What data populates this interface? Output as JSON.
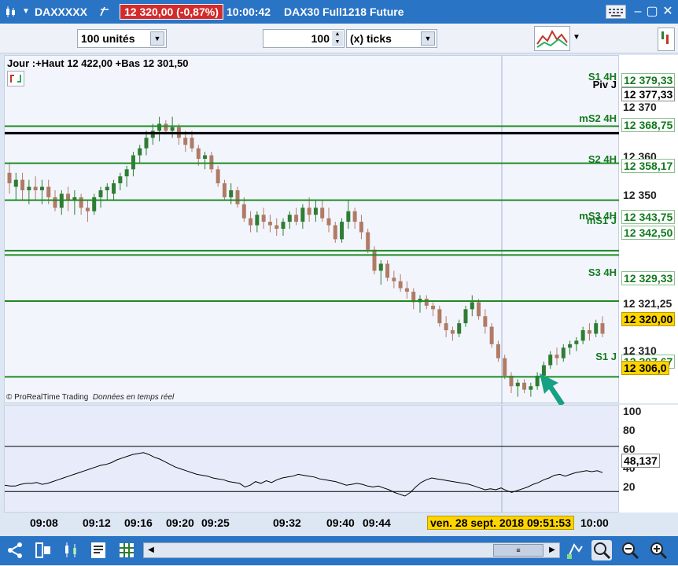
{
  "window": {
    "symbol": "DAXXXXX",
    "last_price": "12 320,00 (-0,87%)",
    "time": "10:00:42",
    "instrument": "DAX30 Full1218 Future"
  },
  "toolbar": {
    "units_value": "100 unités",
    "ticks_count": "100",
    "ticks_unit": "(x) ticks"
  },
  "chart_header": "Jour :+Haut 12 422,00 +Bas 12 301,50",
  "watermark": {
    "brand": "© ProRealTime Trading",
    "feed": "Données en temps réel"
  },
  "level_labels": [
    {
      "text": "S1 4H"
    },
    {
      "text": "Piv J"
    },
    {
      "text": "mS2 4H"
    },
    {
      "text": "S2 4H"
    },
    {
      "text": "mS3 4H"
    },
    {
      "text": "mS1 J"
    },
    {
      "text": "S3 4H"
    },
    {
      "text": "S1 J"
    }
  ],
  "price_axis": [
    {
      "text": "12 379,33",
      "style": "green"
    },
    {
      "text": "12 377,33",
      "style": "black"
    },
    {
      "text": "12 370",
      "style": "plain"
    },
    {
      "text": "12 368,75",
      "style": "green"
    },
    {
      "text": "12 360",
      "style": "plain"
    },
    {
      "text": "12 358,17",
      "style": "green"
    },
    {
      "text": "12 350",
      "style": "plain"
    },
    {
      "text": "12 343,75",
      "style": "green"
    },
    {
      "text": "12 342,50",
      "style": "green"
    },
    {
      "text": "12 329,33",
      "style": "green"
    },
    {
      "text": "12 321,25",
      "style": "plain"
    },
    {
      "text": "12 320,00",
      "style": "yellow"
    },
    {
      "text": "12 310",
      "style": "plain"
    },
    {
      "text": "12 307,67",
      "style": "green"
    },
    {
      "text": "12 306,0",
      "style": "yellow"
    }
  ],
  "indicator_axis": {
    "ticks": [
      "100",
      "80",
      "60",
      "40",
      "20"
    ],
    "current": "48,137"
  },
  "time_axis": {
    "ticks": [
      "09:08",
      "09:12",
      "09:16",
      "09:20",
      "09:25",
      "09:32",
      "09:40",
      "09:44",
      "10:00"
    ],
    "cursor": "ven. 28 sept. 2018 09:51:53"
  },
  "colors": {
    "up": "#2e7d32",
    "down": "#b07b66",
    "level": "#1e8b23",
    "pivot": "#000000",
    "highlight": "#ffd400",
    "title_bar": "#2a74c5",
    "arrow": "#16a085"
  },
  "chart_data": {
    "type": "candlestick",
    "ylim": [
      12300,
      12385
    ],
    "levels": [
      {
        "name": "S1 4H",
        "value": 12379.33
      },
      {
        "name": "Piv J",
        "value": 12377.33
      },
      {
        "name": "mS2 4H",
        "value": 12368.75
      },
      {
        "name": "S2 4H",
        "value": 12358.17
      },
      {
        "name": "mS3 4H",
        "value": 12343.75
      },
      {
        "name": "mS1 J",
        "value": 12342.5
      },
      {
        "name": "S3 4H",
        "value": 12329.33
      },
      {
        "name": "S1 J",
        "value": 12307.67
      }
    ],
    "candles": [
      {
        "o": 12366,
        "h": 12369,
        "l": 12360,
        "c": 12363
      },
      {
        "o": 12362,
        "h": 12366,
        "l": 12358,
        "c": 12364
      },
      {
        "o": 12364,
        "h": 12366,
        "l": 12358,
        "c": 12361
      },
      {
        "o": 12361,
        "h": 12364,
        "l": 12357,
        "c": 12362
      },
      {
        "o": 12362,
        "h": 12365,
        "l": 12358,
        "c": 12361
      },
      {
        "o": 12361,
        "h": 12364,
        "l": 12357,
        "c": 12362
      },
      {
        "o": 12362,
        "h": 12364,
        "l": 12357,
        "c": 12359
      },
      {
        "o": 12359,
        "h": 12361,
        "l": 12355,
        "c": 12356
      },
      {
        "o": 12356,
        "h": 12361,
        "l": 12354,
        "c": 12360
      },
      {
        "o": 12360,
        "h": 12362,
        "l": 12355,
        "c": 12358
      },
      {
        "o": 12358,
        "h": 12361,
        "l": 12354,
        "c": 12359
      },
      {
        "o": 12359,
        "h": 12360,
        "l": 12354,
        "c": 12356
      },
      {
        "o": 12356,
        "h": 12358,
        "l": 12352,
        "c": 12355
      },
      {
        "o": 12355,
        "h": 12360,
        "l": 12354,
        "c": 12359
      },
      {
        "o": 12359,
        "h": 12362,
        "l": 12356,
        "c": 12361
      },
      {
        "o": 12361,
        "h": 12363,
        "l": 12358,
        "c": 12362
      },
      {
        "o": 12360,
        "h": 12364,
        "l": 12358,
        "c": 12363
      },
      {
        "o": 12363,
        "h": 12366,
        "l": 12361,
        "c": 12365
      },
      {
        "o": 12365,
        "h": 12368,
        "l": 12362,
        "c": 12367
      },
      {
        "o": 12367,
        "h": 12372,
        "l": 12365,
        "c": 12371
      },
      {
        "o": 12371,
        "h": 12374,
        "l": 12369,
        "c": 12373
      },
      {
        "o": 12373,
        "h": 12378,
        "l": 12371,
        "c": 12376
      },
      {
        "o": 12376,
        "h": 12380,
        "l": 12374,
        "c": 12378
      },
      {
        "o": 12378,
        "h": 12382,
        "l": 12375,
        "c": 12380
      },
      {
        "o": 12380,
        "h": 12381,
        "l": 12377,
        "c": 12378
      },
      {
        "o": 12378,
        "h": 12382,
        "l": 12376,
        "c": 12379
      },
      {
        "o": 12379,
        "h": 12380,
        "l": 12374,
        "c": 12376
      },
      {
        "o": 12376,
        "h": 12378,
        "l": 12372,
        "c": 12374
      },
      {
        "o": 12376,
        "h": 12378,
        "l": 12372,
        "c": 12373
      },
      {
        "o": 12373,
        "h": 12374,
        "l": 12368,
        "c": 12370
      },
      {
        "o": 12370,
        "h": 12372,
        "l": 12367,
        "c": 12371
      },
      {
        "o": 12371,
        "h": 12372,
        "l": 12366,
        "c": 12367
      },
      {
        "o": 12367,
        "h": 12368,
        "l": 12362,
        "c": 12363
      },
      {
        "o": 12363,
        "h": 12364,
        "l": 12358,
        "c": 12359
      },
      {
        "o": 12359,
        "h": 12363,
        "l": 12357,
        "c": 12361
      },
      {
        "o": 12361,
        "h": 12362,
        "l": 12356,
        "c": 12357
      },
      {
        "o": 12357,
        "h": 12359,
        "l": 12352,
        "c": 12353
      },
      {
        "o": 12353,
        "h": 12355,
        "l": 12349,
        "c": 12351
      },
      {
        "o": 12351,
        "h": 12355,
        "l": 12349,
        "c": 12354
      },
      {
        "o": 12354,
        "h": 12356,
        "l": 12350,
        "c": 12352
      },
      {
        "o": 12352,
        "h": 12354,
        "l": 12349,
        "c": 12351
      },
      {
        "o": 12351,
        "h": 12353,
        "l": 12348,
        "c": 12350
      },
      {
        "o": 12350,
        "h": 12353,
        "l": 12348,
        "c": 12352
      },
      {
        "o": 12352,
        "h": 12355,
        "l": 12350,
        "c": 12354
      },
      {
        "o": 12354,
        "h": 12356,
        "l": 12351,
        "c": 12352
      },
      {
        "o": 12352,
        "h": 12357,
        "l": 12350,
        "c": 12356
      },
      {
        "o": 12356,
        "h": 12359,
        "l": 12352,
        "c": 12354
      },
      {
        "o": 12354,
        "h": 12358,
        "l": 12352,
        "c": 12356
      },
      {
        "o": 12356,
        "h": 12358,
        "l": 12352,
        "c": 12353
      },
      {
        "o": 12353,
        "h": 12356,
        "l": 12349,
        "c": 12351
      },
      {
        "o": 12351,
        "h": 12352,
        "l": 12346,
        "c": 12347
      },
      {
        "o": 12347,
        "h": 12353,
        "l": 12346,
        "c": 12352
      },
      {
        "o": 12352,
        "h": 12358,
        "l": 12350,
        "c": 12355
      },
      {
        "o": 12355,
        "h": 12356,
        "l": 12350,
        "c": 12352
      },
      {
        "o": 12352,
        "h": 12354,
        "l": 12347,
        "c": 12349
      },
      {
        "o": 12349,
        "h": 12350,
        "l": 12343,
        "c": 12344
      },
      {
        "o": 12344,
        "h": 12345,
        "l": 12337,
        "c": 12338
      },
      {
        "o": 12338,
        "h": 12341,
        "l": 12334,
        "c": 12340
      },
      {
        "o": 12340,
        "h": 12341,
        "l": 12335,
        "c": 12336
      },
      {
        "o": 12336,
        "h": 12338,
        "l": 12333,
        "c": 12335
      },
      {
        "o": 12335,
        "h": 12337,
        "l": 12332,
        "c": 12333
      },
      {
        "o": 12333,
        "h": 12335,
        "l": 12330,
        "c": 12332
      },
      {
        "o": 12332,
        "h": 12333,
        "l": 12327,
        "c": 12329
      },
      {
        "o": 12329,
        "h": 12331,
        "l": 12326,
        "c": 12330
      },
      {
        "o": 12330,
        "h": 12331,
        "l": 12327,
        "c": 12328
      },
      {
        "o": 12328,
        "h": 12329,
        "l": 12325,
        "c": 12327
      },
      {
        "o": 12327,
        "h": 12328,
        "l": 12322,
        "c": 12323
      },
      {
        "o": 12323,
        "h": 12325,
        "l": 12319,
        "c": 12321
      },
      {
        "o": 12321,
        "h": 12322,
        "l": 12318,
        "c": 12320
      },
      {
        "o": 12320,
        "h": 12324,
        "l": 12319,
        "c": 12323
      },
      {
        "o": 12323,
        "h": 12328,
        "l": 12322,
        "c": 12327
      },
      {
        "o": 12327,
        "h": 12331,
        "l": 12325,
        "c": 12329
      },
      {
        "o": 12329,
        "h": 12330,
        "l": 12324,
        "c": 12325
      },
      {
        "o": 12325,
        "h": 12327,
        "l": 12320,
        "c": 12322
      },
      {
        "o": 12322,
        "h": 12323,
        "l": 12316,
        "c": 12317
      },
      {
        "o": 12317,
        "h": 12318,
        "l": 12312,
        "c": 12313
      },
      {
        "o": 12313,
        "h": 12314,
        "l": 12307,
        "c": 12308
      },
      {
        "o": 12308,
        "h": 12309,
        "l": 12303,
        "c": 12305
      },
      {
        "o": 12305,
        "h": 12307,
        "l": 12302,
        "c": 12306
      },
      {
        "o": 12306,
        "h": 12307,
        "l": 12303,
        "c": 12304
      },
      {
        "o": 12304,
        "h": 12306,
        "l": 12302,
        "c": 12305
      },
      {
        "o": 12305,
        "h": 12309,
        "l": 12304,
        "c": 12308
      },
      {
        "o": 12308,
        "h": 12312,
        "l": 12307,
        "c": 12311
      },
      {
        "o": 12311,
        "h": 12315,
        "l": 12310,
        "c": 12314
      },
      {
        "o": 12314,
        "h": 12316,
        "l": 12311,
        "c": 12313
      },
      {
        "o": 12313,
        "h": 12317,
        "l": 12312,
        "c": 12316
      },
      {
        "o": 12316,
        "h": 12318,
        "l": 12314,
        "c": 12317
      },
      {
        "o": 12317,
        "h": 12319,
        "l": 12315,
        "c": 12318
      },
      {
        "o": 12318,
        "h": 12322,
        "l": 12317,
        "c": 12321
      },
      {
        "o": 12321,
        "h": 12323,
        "l": 12318,
        "c": 12320
      },
      {
        "o": 12320,
        "h": 12324,
        "l": 12319,
        "c": 12323
      },
      {
        "o": 12323,
        "h": 12325,
        "l": 12319,
        "c": 12320
      }
    ],
    "indicator": {
      "ylim": [
        0,
        100
      ],
      "bands": [
        75,
        25
      ],
      "values": [
        32,
        31,
        31,
        33,
        34,
        34,
        35,
        33,
        34,
        36,
        38,
        40,
        42,
        44,
        46,
        48,
        50,
        52,
        54,
        55,
        57,
        60,
        62,
        64,
        66,
        67,
        68,
        66,
        63,
        61,
        58,
        55,
        52,
        50,
        48,
        46,
        44,
        43,
        42,
        40,
        39,
        38,
        36,
        35,
        34,
        30,
        32,
        36,
        34,
        37,
        35,
        38,
        40,
        41,
        42,
        44,
        43,
        42,
        41,
        39,
        38,
        37,
        36,
        34,
        32,
        33,
        34,
        33,
        31,
        30,
        31,
        29,
        27,
        24,
        22,
        20,
        24,
        30,
        35,
        38,
        40,
        39,
        38,
        37,
        36,
        35,
        34,
        33,
        31,
        29,
        27,
        28,
        27,
        29,
        26,
        24,
        26,
        28,
        30,
        33,
        35,
        38,
        40,
        43,
        44,
        42,
        44,
        46,
        47,
        48,
        47,
        48,
        46
      ]
    }
  }
}
